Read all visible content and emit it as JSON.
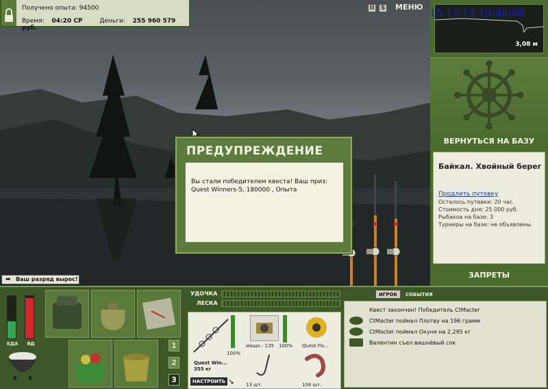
{
  "topinfo": {
    "exp_label": "Получено опыта:",
    "exp_value": "94500",
    "time_label": "Время:",
    "time_value": "04:20 СР",
    "money_label": "Деньги:",
    "money_value": "255 960 579 руб."
  },
  "toolbar": {
    "pause": "II",
    "sound": "S",
    "menu": "МЕНЮ"
  },
  "overlay": {
    "datetime": "15.12.15 19:40:08"
  },
  "minimap": {
    "depth": "3,08 м"
  },
  "right": {
    "back_to_base": "ВЕРНУТЬСЯ НА БАЗУ",
    "location_title": "Байкал. Хвойный берег",
    "extend_link": "Продлить путевку",
    "left_label": "Осталось путевки: 20 час.",
    "day_cost": "Стоимость дня: 25 000 руб.",
    "anglers": "Рыбаков на базе: 3",
    "tournaments": "Турниры на базе: не объявлены",
    "bans": "ЗАПРЕТЫ"
  },
  "dialog": {
    "title": "ПРЕДУПРЕЖДЕНИЕ",
    "message": "Вы стали победителем квеста! Ваш приз: Quest Winners-5, 180000 , Опыта"
  },
  "rank_badge": "Ваш разряд вырос!",
  "stats": {
    "food_label": "ЕДА",
    "poison_label": "ЯД",
    "food_level": 0.4,
    "poison_level": 0.95,
    "colors": {
      "food": "#2fa84f",
      "poison": "#d22a2a"
    }
  },
  "slots": [
    "1",
    "2",
    "3"
  ],
  "lines": {
    "rod_label": "УДОЧКА",
    "line_label": "ЛЕСКА"
  },
  "gear": {
    "rod_name": "Quest Win...",
    "rod_weight": "355 кг",
    "rod_pct": "100%",
    "reel_info": "мощн.: 135",
    "reel_pct": "100%",
    "line_name": "Quest Fis...",
    "hooks": "13 шт.",
    "bait": "104 шт.",
    "configure": "НАСТРОИТЬ"
  },
  "tabs": {
    "player": "ИГРОК",
    "events": "СОБЫТИЯ"
  },
  "news": [
    "Квест закончен! Победитель CtMacter",
    "CtMacter поймал Плотву на 196 грамм",
    "CtMacter поймал Окуня на 2,295 кг",
    "Валентин съел вишнёвый сок"
  ]
}
